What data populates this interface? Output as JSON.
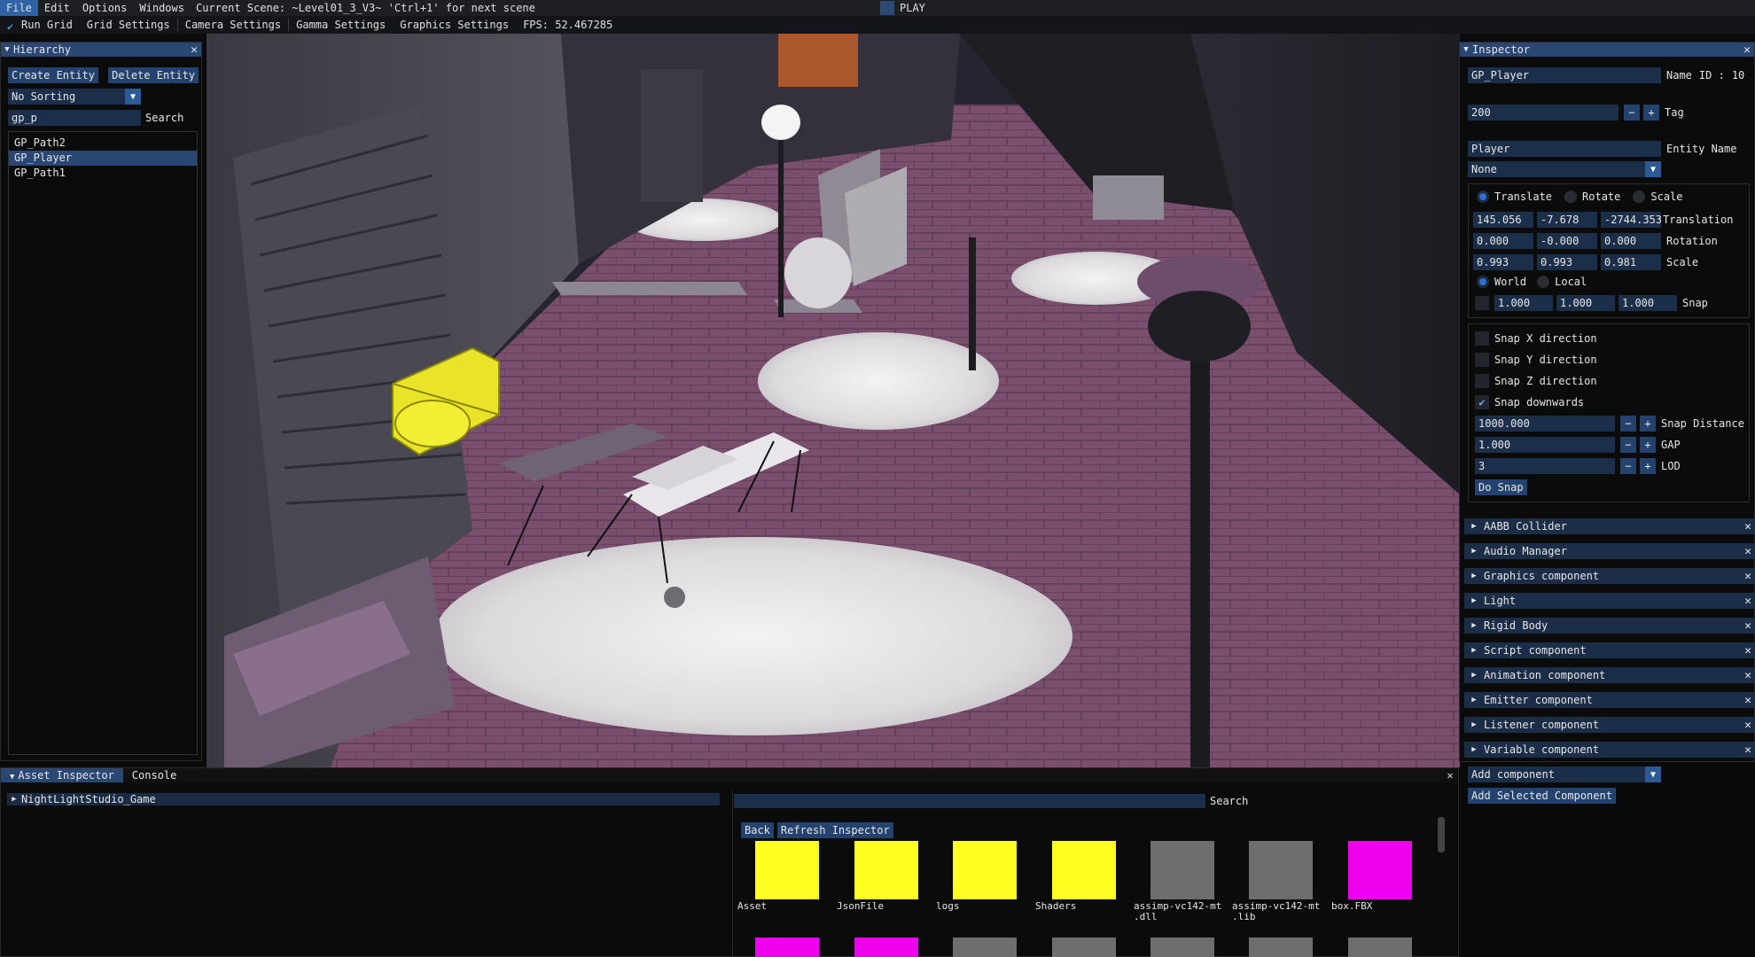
{
  "menubar": {
    "items": [
      "File",
      "Edit",
      "Options",
      "Windows"
    ],
    "scene_info": "Current Scene: ~Level01_3_V3~ 'Ctrl+1' for next scene",
    "play_label": "PLAY"
  },
  "toolbar": {
    "run_grid": "Run Grid",
    "grid_settings": "Grid Settings",
    "camera_settings": "Camera Settings",
    "gamma_settings": "Gamma Settings",
    "graphics_settings": "Graphics Settings",
    "fps": "FPS: 52.467285"
  },
  "hierarchy": {
    "title": "Hierarchy",
    "create_entity": "Create Entity",
    "delete_entity": "Delete Entity",
    "sorting": "No Sorting",
    "search_value": "gp_p",
    "search_label": "Search",
    "items": [
      "GP_Path2",
      "GP_Player",
      "GP_Path1"
    ]
  },
  "inspector": {
    "title": "Inspector",
    "name_value": "GP_Player",
    "name_label": "Name",
    "id_label": "ID :",
    "id_value": "10",
    "tag_value": "200",
    "tag_label": "Tag",
    "entity_name_value": "Player",
    "entity_name_label": "Entity Name",
    "none_value": "None",
    "gizmo": {
      "translate": "Translate",
      "rotate": "Rotate",
      "scale": "Scale",
      "translation": [
        "145.056",
        "-7.678",
        "-2744.353"
      ],
      "translation_label": "Translation",
      "rotation": [
        "0.000",
        "-0.000",
        "0.000"
      ],
      "rotation_label": "Rotation",
      "scale_values": [
        "0.993",
        "0.993",
        "0.981"
      ],
      "scale_label": "Scale",
      "world": "World",
      "local": "Local",
      "snap": [
        "1.000",
        "1.000",
        "1.000"
      ],
      "snap_label": "Snap"
    },
    "snapping": {
      "snap_x": "Snap X direction",
      "snap_y": "Snap Y direction",
      "snap_z": "Snap Z direction",
      "snap_down": "Snap downwards",
      "snap_distance_value": "1000.000",
      "snap_distance_label": "Snap Distance",
      "gap_value": "1.000",
      "gap_label": "GAP",
      "lod_value": "3",
      "lod_label": "LOD",
      "do_snap": "Do Snap"
    },
    "components": [
      "AABB Collider",
      "Audio Manager",
      "Graphics component",
      "Light",
      "Rigid Body",
      "Script component",
      "Animation component",
      "Emitter component",
      "Listener component",
      "Variable component"
    ],
    "add_component": "Add component",
    "add_selected": "Add Selected Component"
  },
  "bottom": {
    "tab_asset": "Asset Inspector",
    "tab_console": "Console",
    "tree_root": "NightLightStudio_Game",
    "search_label": "Search",
    "back": "Back",
    "refresh": "Refresh Inspector",
    "assets": [
      {
        "name": "Asset",
        "color": "#ffff22"
      },
      {
        "name": "JsonFile",
        "color": "#ffff22"
      },
      {
        "name": "logs",
        "color": "#ffff22"
      },
      {
        "name": "Shaders",
        "color": "#ffff22"
      },
      {
        "name": "assimp-vc142-mt\n.dll",
        "color": "#6e6e6e"
      },
      {
        "name": "assimp-vc142-mt\n.lib",
        "color": "#6e6e6e"
      },
      {
        "name": "box.FBX",
        "color": "#ee00ee"
      }
    ],
    "row2_colors": [
      "#ee00ee",
      "#ee00ee",
      "#6e6e6e",
      "#6e6e6e",
      "#6e6e6e",
      "#6e6e6e",
      "#6e6e6e"
    ]
  }
}
